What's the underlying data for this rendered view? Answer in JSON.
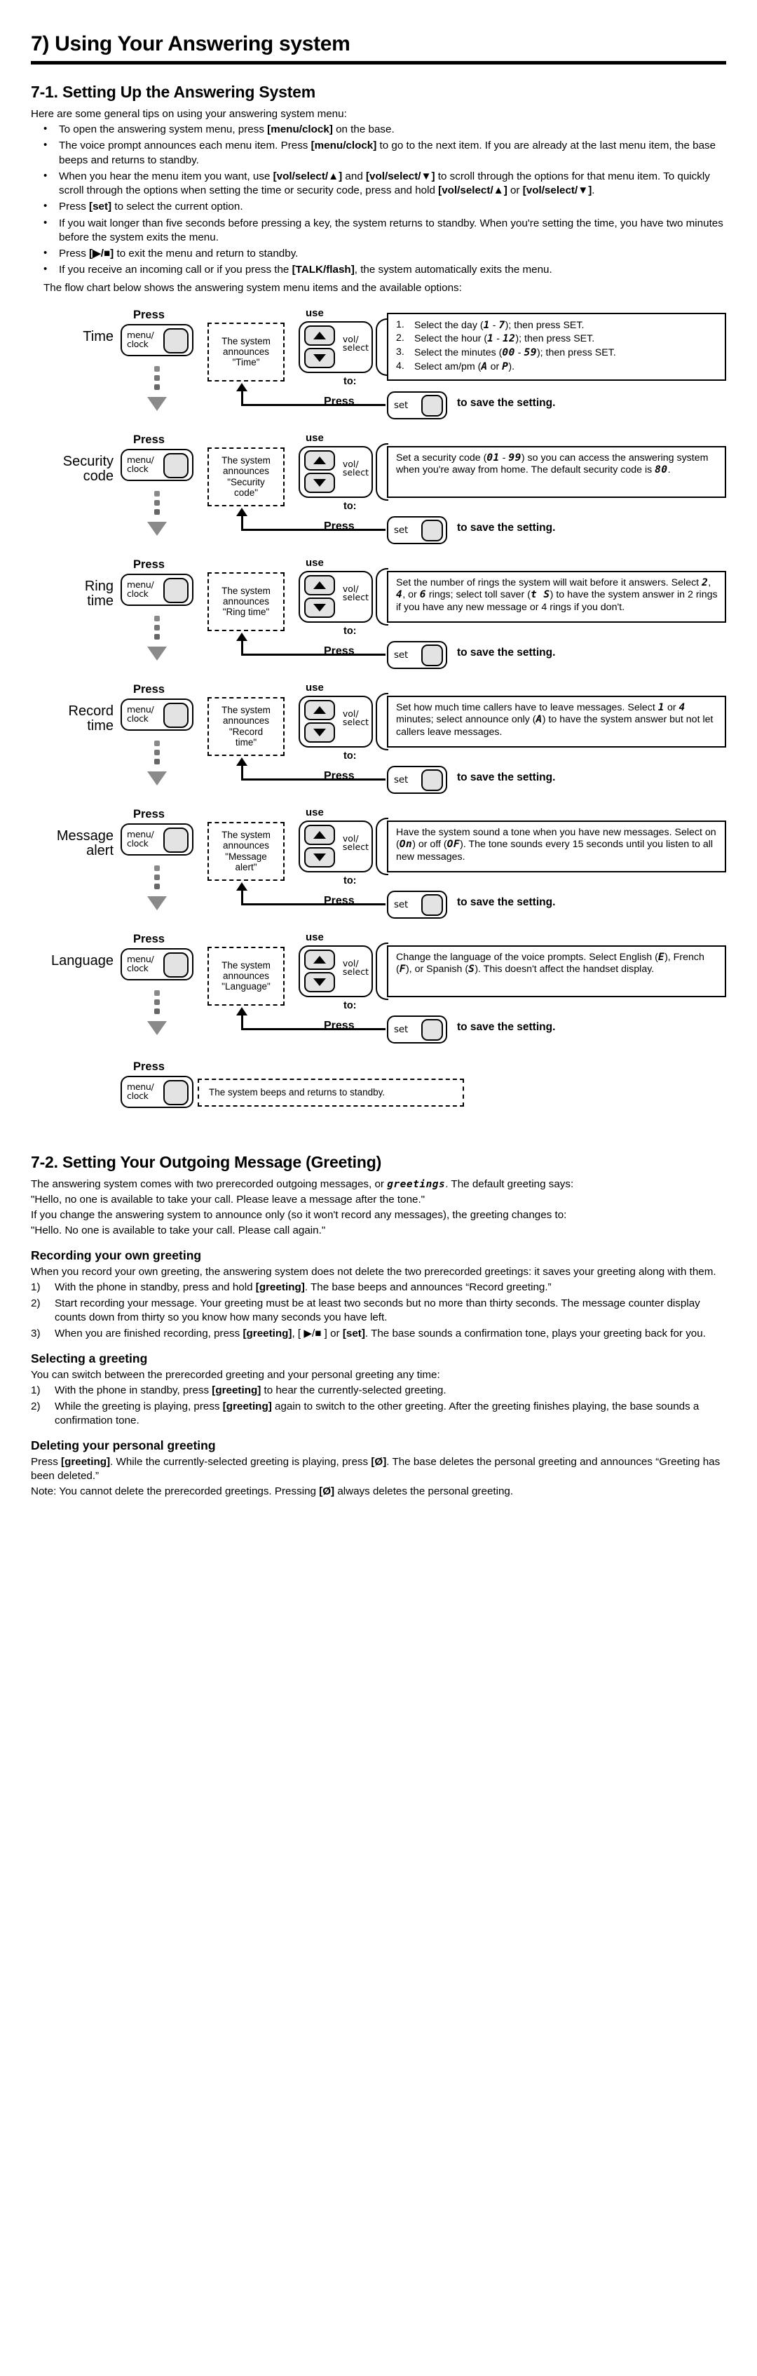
{
  "doc": {
    "section_title": "7) Using Your Answering system",
    "sub1_title": "7-1. Setting Up the Answering System",
    "intro": "Here are some general tips on using your answering system menu:"
  },
  "tips": [
    "To open the answering system menu, press [menu/clock] on the base.",
    "The voice prompt announces each menu item. Press [menu/clock] to go to the next item. If you are already at the last menu item, the base beeps and returns to standby.",
    "When you hear the menu item you want, use [vol/select/▲] and [vol/select/▼] to scroll through the options for that menu item. To quickly scroll through the options when setting the time or security code, press and hold [vol/select/▲] or [vol/select/▼].",
    "Press [set] to select the current option.",
    "If you wait longer than five seconds before pressing a key, the system returns to standby. When you're setting the time, you have two minutes before the system exits the menu.",
    "Press [▶/■] to exit the menu and return to standby.",
    "If you receive an incoming call or if you press the [TALK/flash], the system automatically exits the menu."
  ],
  "flow_intro": "The flow chart below shows the answering system menu items and the available options:",
  "labels": {
    "press": "Press",
    "use": "use",
    "to": "to:",
    "menu_key_line1": "menu/",
    "menu_key_line2": "clock",
    "vol_line1": "vol/",
    "vol_line2": "select",
    "set_key": "set",
    "save": "to save the setting."
  },
  "flow_rows": [
    {
      "name": "Time",
      "announce": "The system announces \"Time\"",
      "announce_lines": [
        "The system",
        "announces",
        "\"Time\""
      ],
      "detail_type": "list",
      "detail_items": [
        "1.|Select the day (<i>1</i> - <i>7</i>); then press SET.",
        "2.|Select the hour (<i>1</i> - <i>12</i>); then press SET.",
        "3.|Select the minutes (<i>00</i> - <i>59</i>); then press SET.",
        "4.|Select am/pm (<i>A</i> or <i>P</i>)."
      ]
    },
    {
      "name": "Security code",
      "announce_lines": [
        "The system",
        "announces",
        "\"Security",
        "code\""
      ],
      "detail_type": "para",
      "detail_text": "Set a security code (<i>01</i> - <i>99</i>) so you can access the answering system when you're away from home. The default security code is <i>80</i>."
    },
    {
      "name": "Ring time",
      "announce_lines": [
        "The system",
        "announces",
        "\"Ring time\""
      ],
      "detail_type": "para",
      "detail_text": "Set the number of rings the system will wait before it answers. Select <i>2</i>, <i>4</i>, or <i>6</i> rings; select toll saver (<i>t S</i>) to have the system answer in 2 rings if you have any new message or 4 rings if you don't."
    },
    {
      "name": "Record time",
      "announce_lines": [
        "The system",
        "announces",
        "\"Record",
        "time\""
      ],
      "detail_type": "para",
      "detail_text": "Set how much time callers have to leave messages. Select <i>1</i> or <i>4</i> minutes; select announce only (<i>A</i>) to have the system answer but not let callers leave messages."
    },
    {
      "name": "Message alert",
      "announce_lines": [
        "The system",
        "announces",
        "\"Message",
        "alert\""
      ],
      "detail_type": "para",
      "detail_text": "Have the system sound a tone when you have new messages. Select on (<i>On</i>) or off (<i>OF</i>). The tone sounds every 15 seconds until you listen to all new messages."
    },
    {
      "name": "Language",
      "announce_lines": [
        "The system",
        "announces",
        "\"Language\""
      ],
      "detail_type": "para",
      "detail_text": "Change the language of the voice prompts. Select English (<i>E</i>), French (<i>F</i>), or Spanish (<i>S</i>). This doesn't affect the handset display."
    }
  ],
  "flow_final": {
    "press": "Press",
    "text": "The system beeps and returns to standby."
  },
  "sub2": {
    "title": "7-2. Setting Your Outgoing Message (Greeting)",
    "p1": "The answering system comes with two prerecorded outgoing messages, or <i>greetings</i>. The default greeting says:",
    "p2": "\"Hello, no one is available to take your call. Please leave a message after the tone.\"",
    "p3": "If you change the answering system to announce only (so it won't record any messages), the greeting changes to:",
    "p4": "\"Hello. No one is available to take your call. Please call again.\"",
    "record_title": "Recording your own greeting",
    "record_p": "When you record your own greeting, the answering system does not delete the two prerecorded greetings: it saves your greeting along with them.",
    "record_steps": [
      "1)|With the phone in standby, press and hold <b>[greeting]</b>. The base beeps and announces “Record greeting.”",
      "2)|Start recording your message. Your greeting must be at least two seconds but no more than thirty seconds. The message counter display counts down from thirty so you know how many seconds you have left.",
      "3)|When you are finished recording, press <b>[greeting]</b>, [ ▶/■ ] or <b>[set]</b>. The base sounds a confirmation tone, plays your greeting back for you."
    ],
    "select_title": "Selecting a greeting",
    "select_p": "You can switch between the prerecorded greeting and your personal greeting any time:",
    "select_steps": [
      "1)|With the phone in standby, press <b>[greeting]</b> to hear the currently-selected greeting.",
      "2)|While the greeting is playing, press <b>[greeting]</b> again to switch to the other greeting. After the greeting finishes playing, the base sounds a confirmation tone."
    ],
    "delete_title": "Deleting your personal greeting",
    "delete_p1": "Press <b>[greeting]</b>. While the currently-selected greeting is playing, press <b>[Ø]</b>. The base deletes the personal greeting and announces “Greeting has been deleted.”",
    "delete_p2": "Note:  You cannot delete the prerecorded greetings. Pressing <b>[Ø]</b> always deletes the personal greeting."
  }
}
